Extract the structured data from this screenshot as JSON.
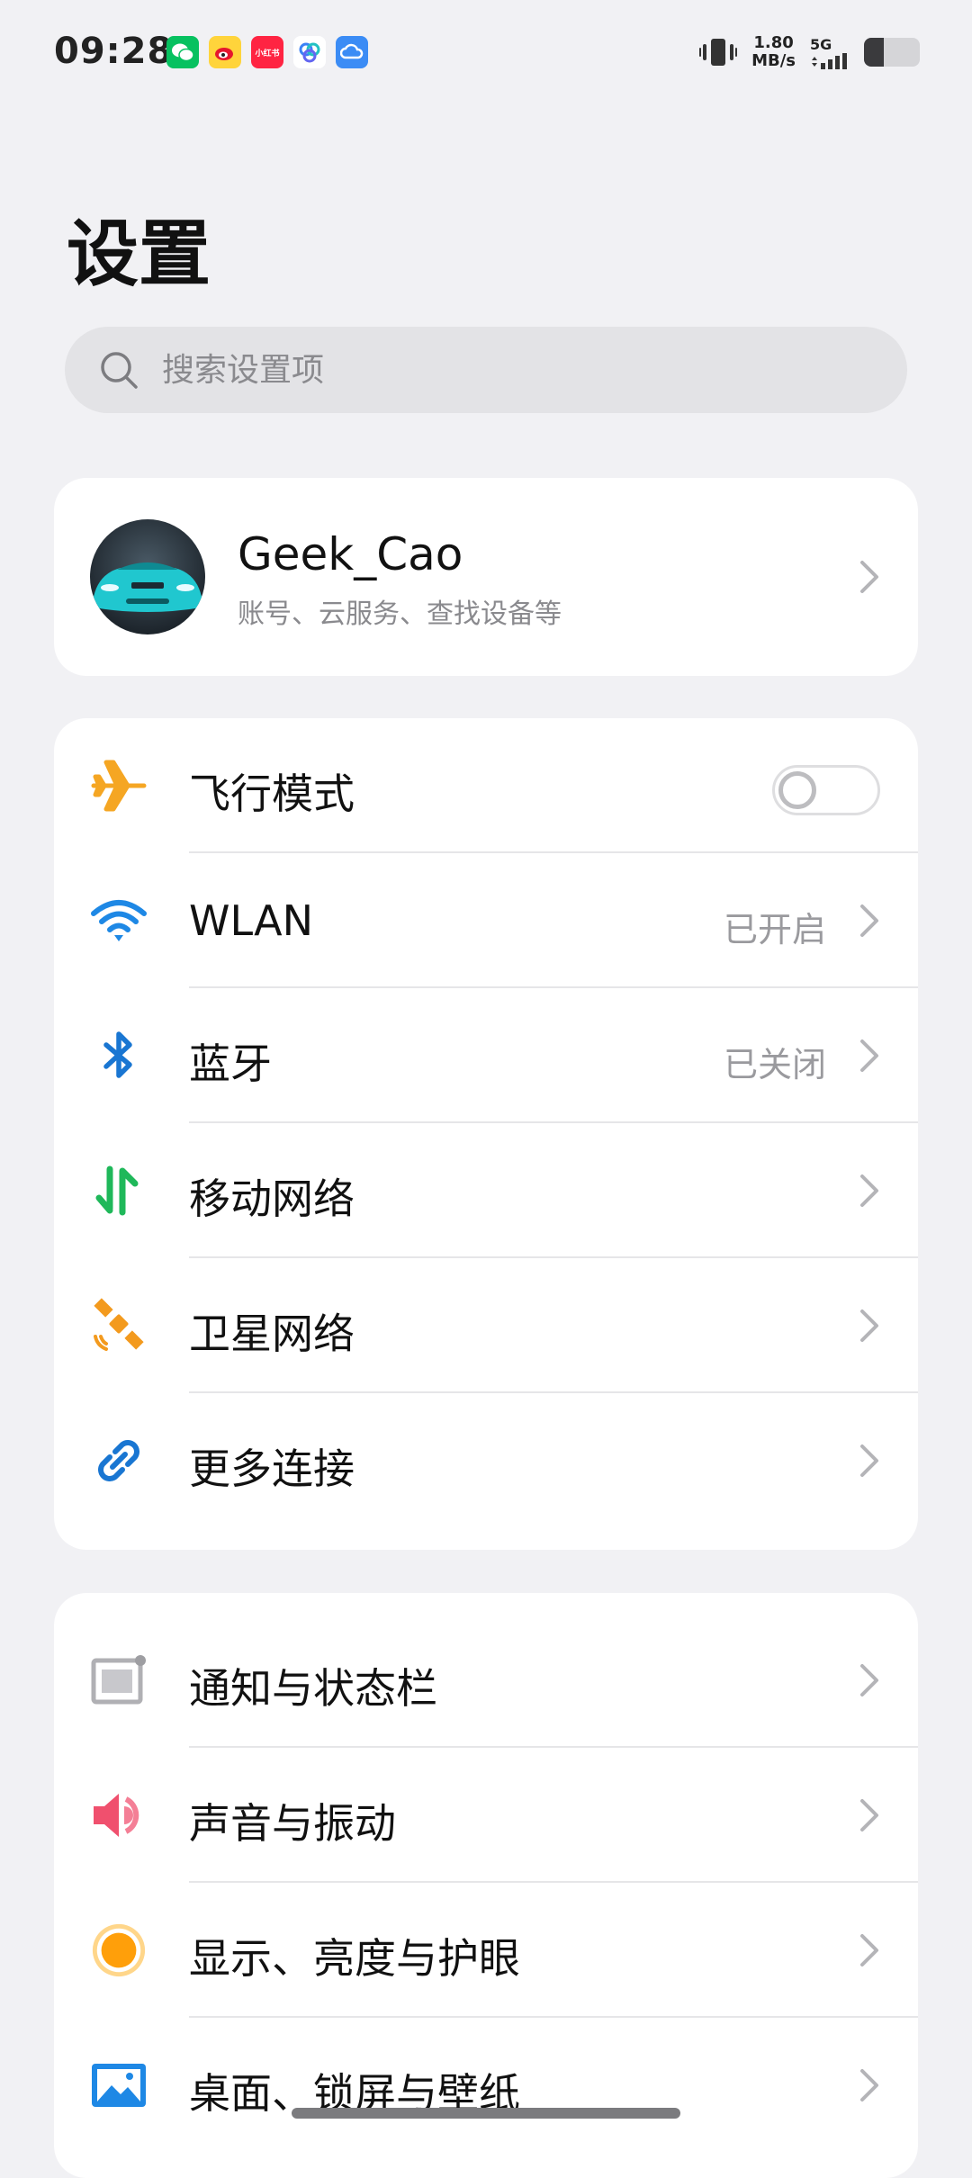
{
  "status_bar": {
    "time": "09:28",
    "net_speed_value": "1.80",
    "net_speed_unit": "MB/s",
    "network_type": "5G",
    "battery_level": 0.35,
    "notification_apps": [
      "wechat-icon",
      "weibo-icon",
      "xiaohongshu-icon",
      "alipay-icon",
      "cloud-icon"
    ],
    "xiaohongshu_text": "小红书"
  },
  "header": {
    "title": "设置"
  },
  "search": {
    "placeholder": "搜索设置项"
  },
  "account": {
    "name": "Geek_Cao",
    "subtitle": "账号、云服务、查找设备等"
  },
  "connectivity": [
    {
      "label": "飞行模式",
      "icon": "airplane-icon",
      "icon_color": "#f5a623",
      "toggle": true,
      "toggle_on": false
    },
    {
      "label": "WLAN",
      "value": "已开启",
      "icon": "wifi-icon",
      "icon_color": "#1e88e5"
    },
    {
      "label": "蓝牙",
      "value": "已关闭",
      "icon": "bluetooth-icon",
      "icon_color": "#1976d2"
    },
    {
      "label": "移动网络",
      "icon": "mobile-data-icon",
      "icon_color": "#1fb85a"
    },
    {
      "label": "卫星网络",
      "icon": "satellite-icon",
      "icon_color": "#f39a1e"
    },
    {
      "label": "更多连接",
      "icon": "link-icon",
      "icon_color": "#1976d2"
    }
  ],
  "system": [
    {
      "label": "通知与状态栏",
      "icon": "notification-icon",
      "icon_color": "#9e9ea2"
    },
    {
      "label": "声音与振动",
      "icon": "sound-icon",
      "icon_color": "#f0506e"
    },
    {
      "label": "显示、亮度与护眼",
      "icon": "brightness-icon",
      "icon_color": "#ff9f0a"
    },
    {
      "label": "桌面、锁屏与壁纸",
      "icon": "wallpaper-icon",
      "icon_color": "#1e88e5"
    }
  ]
}
